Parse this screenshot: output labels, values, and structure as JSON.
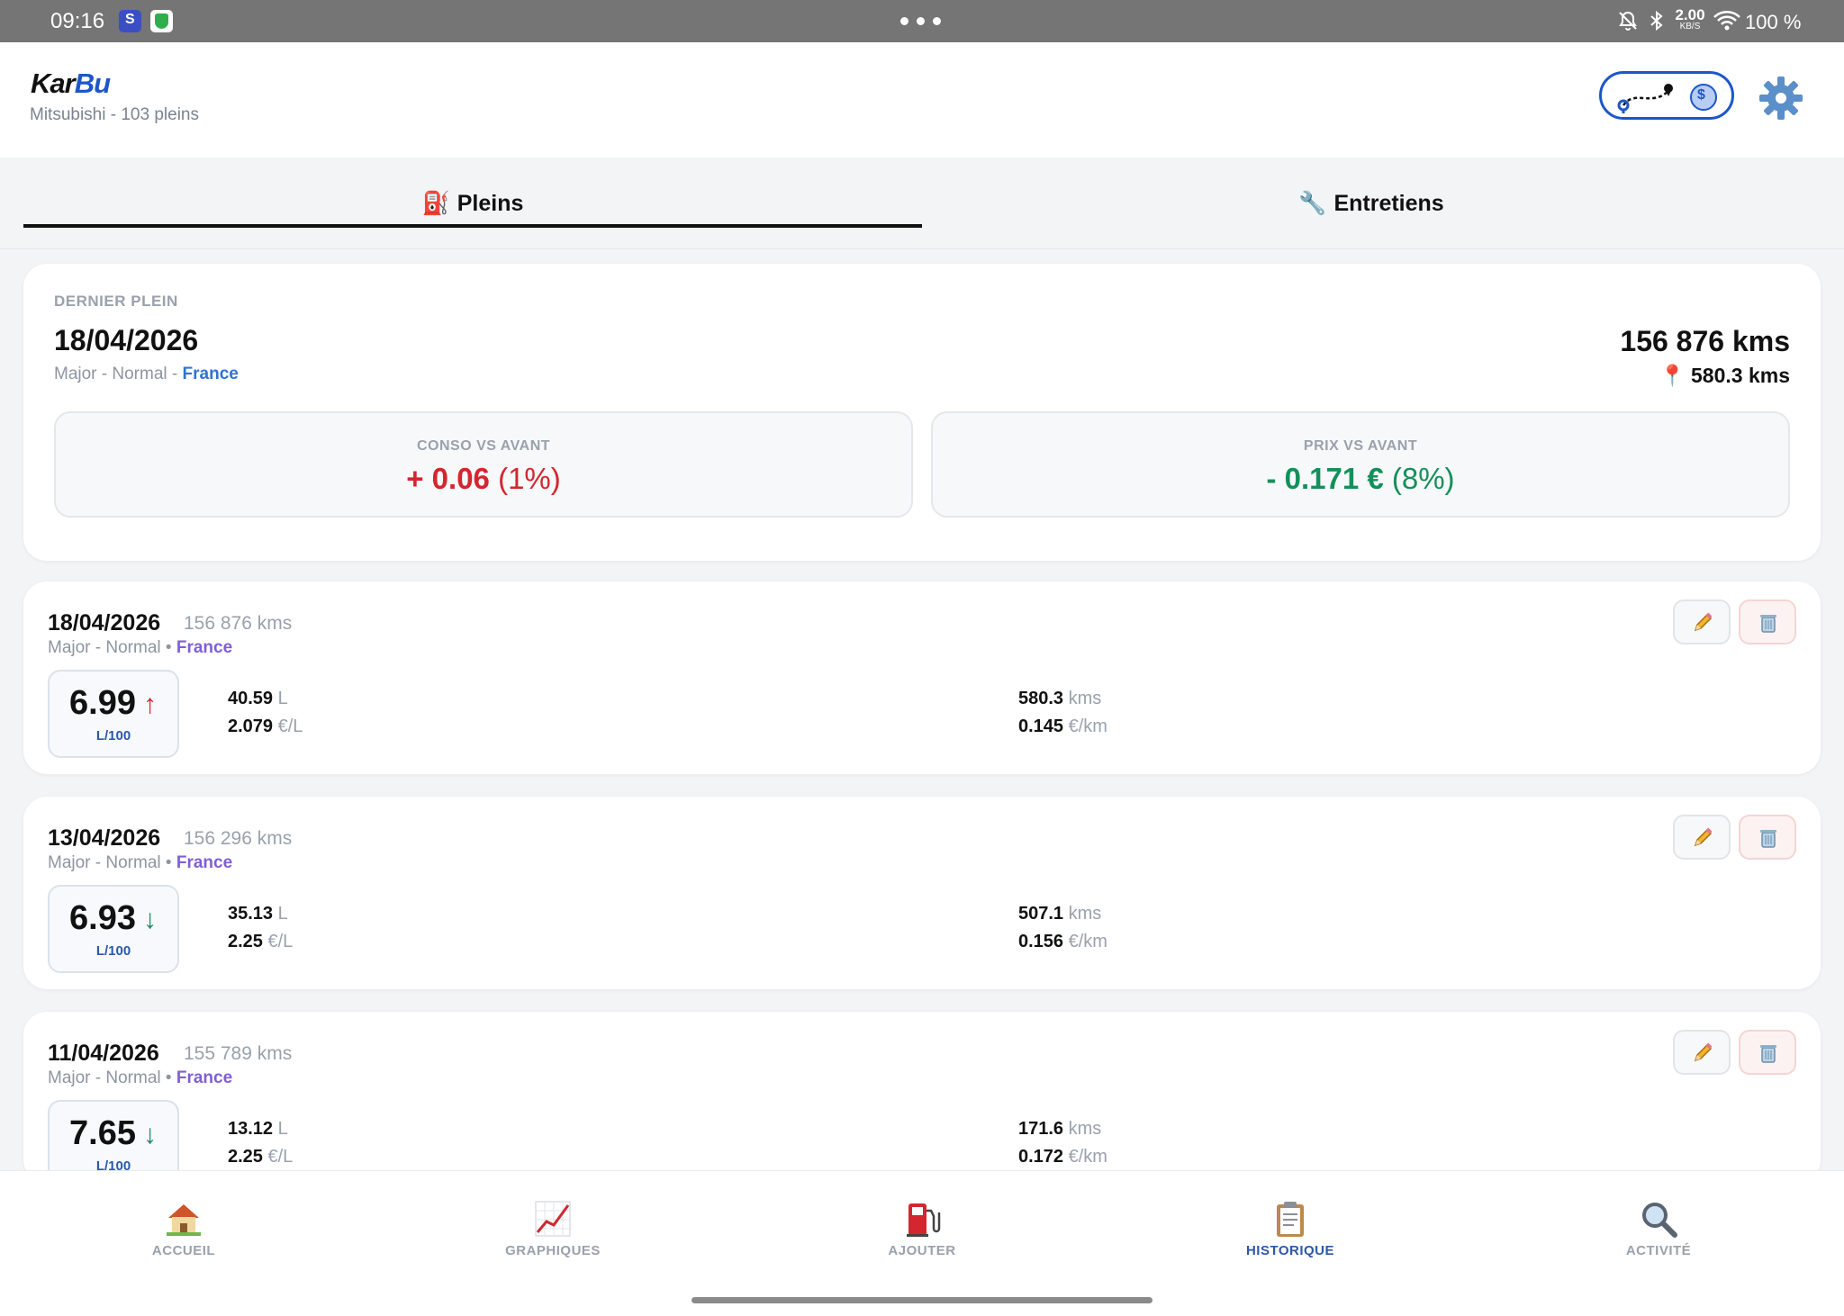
{
  "status_bar": {
    "time": "09:16",
    "net_speed_value": "2.00",
    "net_speed_unit": "KB/S",
    "battery": "100 %",
    "icons": [
      "bell-muted-icon",
      "bluetooth-icon",
      "wifi-icon"
    ]
  },
  "app": {
    "logo_part1": "Kar",
    "logo_part2": "Bu",
    "subtitle": "Mitsubishi - 103 pleins",
    "brand_color": "#1d56c9"
  },
  "tabs": [
    {
      "label": "Pleins",
      "icon": "fuel-pump-icon",
      "active": true
    },
    {
      "label": "Entretiens",
      "icon": "wrench-icon",
      "active": false
    }
  ],
  "latest": {
    "label": "DERNIER PLEIN",
    "date": "18/04/2026",
    "meta_prefix": "Major - Normal - ",
    "country": "France",
    "odometer": "156 876 kms",
    "distance": "580.3 kms",
    "conso": {
      "label": "CONSO VS AVANT",
      "value": "+ 0.06",
      "pct": "(1%)",
      "color": "#d3262e"
    },
    "prix": {
      "label": "PRIX VS AVANT",
      "value": "- 0.171 €",
      "pct": "(8%)",
      "color": "#14905a"
    }
  },
  "entries": [
    {
      "date": "18/04/2026",
      "odometer": "156 876 kms",
      "meta_prefix": "Major - Normal • ",
      "country": "France",
      "conso": "6.99",
      "trend": "↑",
      "trend_color": "#d3262e",
      "conso_unit": "L/100",
      "liters": "40.59",
      "liters_unit": "L",
      "price_per_l": "2.079",
      "price_per_l_unit": "€/L",
      "distance": "580.3",
      "distance_unit": "kms",
      "price_per_km": "0.145",
      "price_per_km_unit": "€/km"
    },
    {
      "date": "13/04/2026",
      "odometer": "156 296 kms",
      "meta_prefix": "Major - Normal • ",
      "country": "France",
      "conso": "6.93",
      "trend": "↓",
      "trend_color": "#14905a",
      "conso_unit": "L/100",
      "liters": "35.13",
      "liters_unit": "L",
      "price_per_l": "2.25",
      "price_per_l_unit": "€/L",
      "distance": "507.1",
      "distance_unit": "kms",
      "price_per_km": "0.156",
      "price_per_km_unit": "€/km"
    },
    {
      "date": "11/04/2026",
      "odometer": "155 789 kms",
      "meta_prefix": "Major - Normal • ",
      "country": "France",
      "conso": "7.65",
      "trend": "↓",
      "trend_color": "#14905a",
      "conso_unit": "L/100",
      "liters": "13.12",
      "liters_unit": "L",
      "price_per_l": "2.25",
      "price_per_l_unit": "€/L",
      "distance": "171.6",
      "distance_unit": "kms",
      "price_per_km": "0.172",
      "price_per_km_unit": "€/km"
    }
  ],
  "bottom_nav": [
    {
      "label": "ACCUEIL",
      "icon": "house-icon",
      "active": false
    },
    {
      "label": "GRAPHIQUES",
      "icon": "chart-icon",
      "active": false
    },
    {
      "label": "AJOUTER",
      "icon": "fuel-pump-icon",
      "active": false
    },
    {
      "label": "HISTORIQUE",
      "icon": "clipboard-icon",
      "active": true
    },
    {
      "label": "ACTIVITÉ",
      "icon": "magnifier-icon",
      "active": false
    }
  ]
}
